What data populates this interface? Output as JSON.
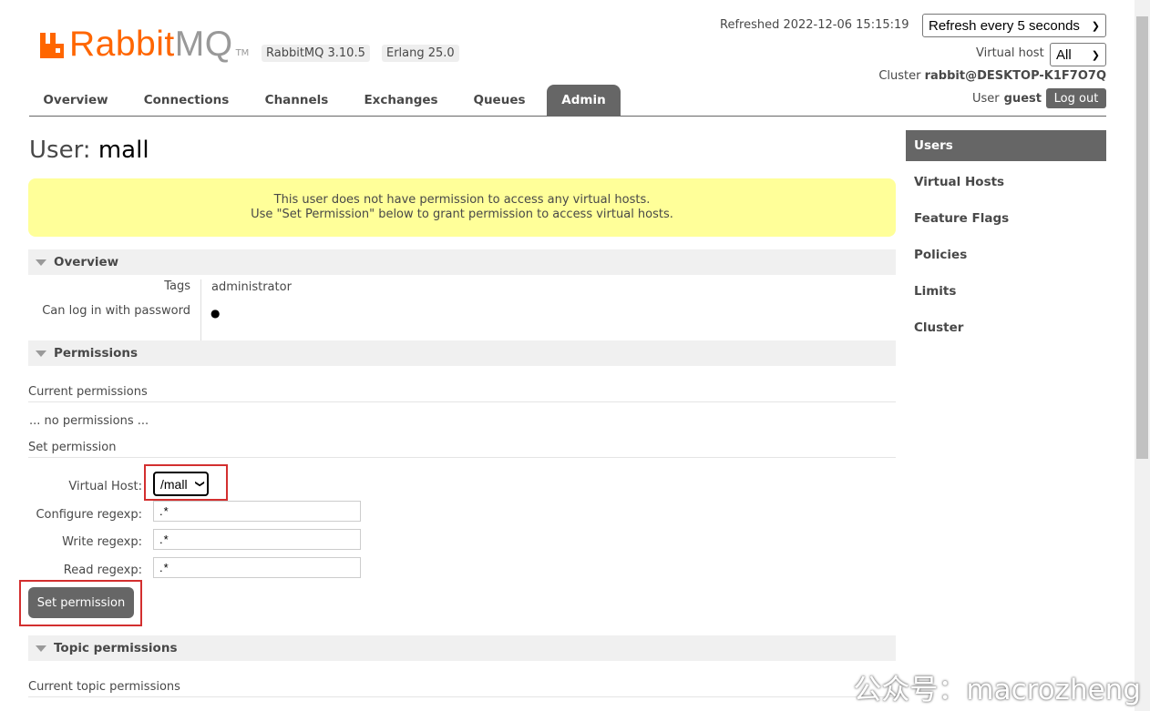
{
  "logo": {
    "rabbit": "Rabbit",
    "mq": "MQ",
    "tm": "TM"
  },
  "versions": {
    "rabbitmq": "RabbitMQ 3.10.5",
    "erlang": "Erlang 25.0"
  },
  "header": {
    "refreshed": "Refreshed 2022-12-06 15:15:19",
    "refresh_select": "Refresh every 5 seconds",
    "vhost_label": "Virtual host",
    "vhost_select": "All",
    "cluster_label": "Cluster",
    "cluster_name": "rabbit@DESKTOP-K1F7O7Q",
    "user_label": "User",
    "user_name": "guest",
    "logout": "Log out"
  },
  "tabs": [
    "Overview",
    "Connections",
    "Channels",
    "Exchanges",
    "Queues",
    "Admin"
  ],
  "active_tab": "Admin",
  "sidebar": [
    "Users",
    "Virtual Hosts",
    "Feature Flags",
    "Policies",
    "Limits",
    "Cluster"
  ],
  "page": {
    "title_prefix": "User:",
    "title_name": "mall"
  },
  "warning": {
    "line1": "This user does not have permission to access any virtual hosts.",
    "line2": "Use \"Set Permission\" below to grant permission to access virtual hosts."
  },
  "overview": {
    "heading": "Overview",
    "tags_label": "Tags",
    "tags_value": "administrator",
    "login_label": "Can log in with password",
    "login_value": "●"
  },
  "permissions": {
    "heading": "Permissions",
    "current_heading": "Current permissions",
    "no_permissions": "... no permissions ...",
    "set_heading": "Set permission",
    "vhost_label": "Virtual Host:",
    "vhost_value": "/mall",
    "configure_label": "Configure regexp:",
    "configure_value": ".*",
    "write_label": "Write regexp:",
    "write_value": ".*",
    "read_label": "Read regexp:",
    "read_value": ".*",
    "submit": "Set permission"
  },
  "topic": {
    "heading": "Topic permissions",
    "current_heading": "Current topic permissions"
  },
  "watermark": "公众号：macrozheng",
  "colors": {
    "brand": "#ff6600",
    "dark": "#666666",
    "warning_bg": "#ffff99",
    "highlight": "#d32f2f"
  }
}
